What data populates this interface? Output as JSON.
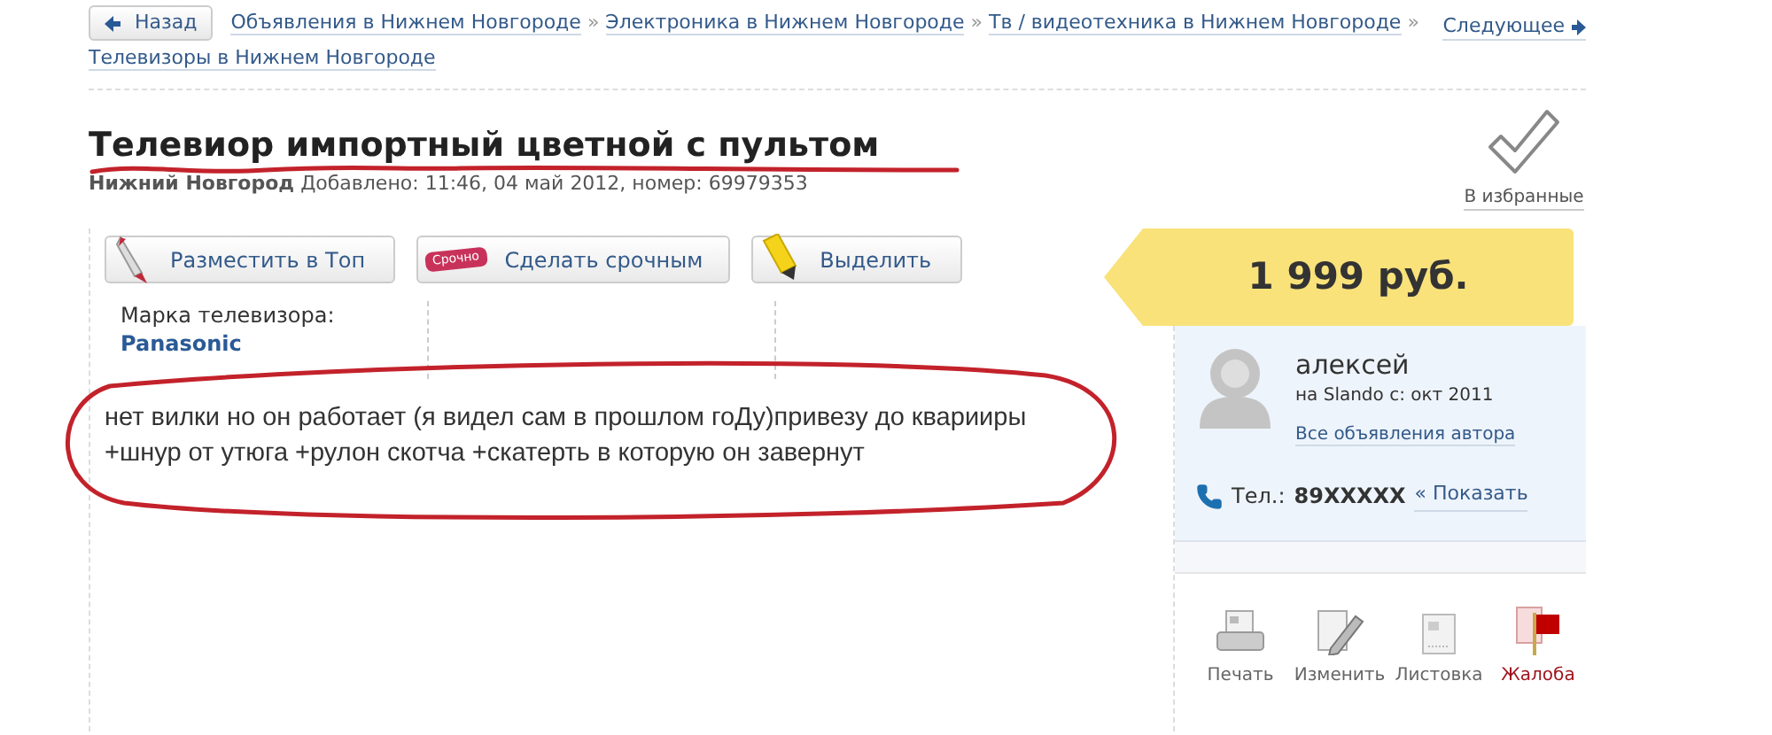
{
  "nav": {
    "back": "Назад",
    "breadcrumbs": [
      {
        "label": "Объявления в Нижнем Новгороде",
        "separator": "»"
      },
      {
        "label": "Электроника в Нижнем Новгороде",
        "separator": "»"
      },
      {
        "label": "Тв / видеотехника в Нижнем Новгороде",
        "separator": "»"
      },
      {
        "label": "Телевизоры в Нижнем Новгороде"
      }
    ],
    "next": "Следующее"
  },
  "listing": {
    "title": "Телевиор импортный цветной с пультом",
    "city": "Нижний Новгород",
    "meta": "Добавлено: 11:46, 04 май 2012, номер: 69979353",
    "favorite": "В избранные",
    "promo_buttons": [
      {
        "kind": "top",
        "label": "Разместить в Топ"
      },
      {
        "kind": "urgent",
        "label": "Сделать срочным",
        "badge": "Срочно"
      },
      {
        "kind": "highlight",
        "label": "Выделить"
      }
    ],
    "attributes": [
      {
        "label": "Марка телевизора:",
        "value": "Panasonic"
      }
    ],
    "description": "нет вилки но он работает (я видел сам в прошлом гоДу)привезу до кварииры +шнур от утюга +рулон скотча +скатерть в которую он завернут"
  },
  "price": "1 999 руб.",
  "seller": {
    "name": "алексей",
    "since": "на Slando с: окт 2011",
    "all_ads": "Все объявления автора",
    "phone_label": "Тел.:",
    "phone": "89XXXXX",
    "show_phone": "« Показать"
  },
  "actions": [
    {
      "kind": "print",
      "label": "Печать"
    },
    {
      "kind": "edit",
      "label": "Изменить"
    },
    {
      "kind": "flyer",
      "label": "Листовка"
    },
    {
      "kind": "report",
      "label": "Жалоба"
    }
  ]
}
